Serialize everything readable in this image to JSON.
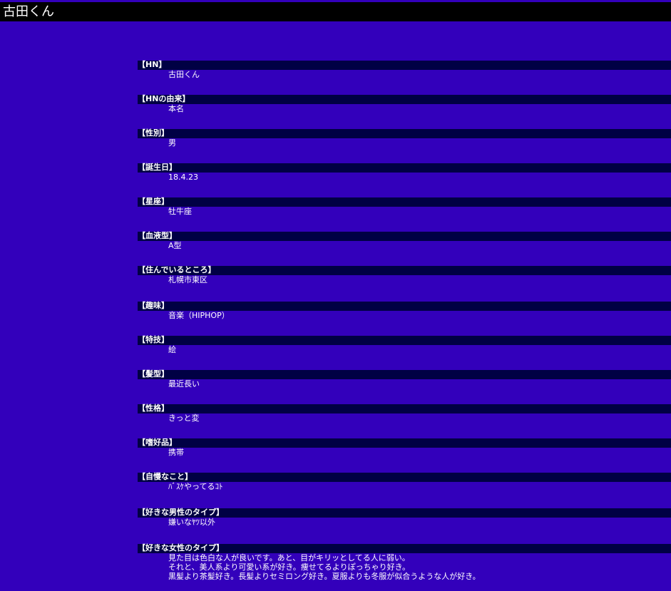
{
  "page": {
    "title": "古田くん"
  },
  "profile": {
    "fields": [
      {
        "label": "【HN】",
        "value": "古田くん"
      },
      {
        "label": "【HNの由来】",
        "value": "本名"
      },
      {
        "label": "【性別】",
        "value": "男"
      },
      {
        "label": "【誕生日】",
        "value": "18.4.23"
      },
      {
        "label": "【星座】",
        "value": "牡牛座"
      },
      {
        "label": "【血液型】",
        "value": "A型"
      },
      {
        "label": "【住んでいるところ】",
        "value": "札幌市東区"
      },
      {
        "label": "【趣味】",
        "value": "音楽（HIPHOP）"
      },
      {
        "label": "【特技】",
        "value": "絵"
      },
      {
        "label": "【髪型】",
        "value": "最近長い"
      },
      {
        "label": "【性格】",
        "value": "きっと変"
      },
      {
        "label": "【嗜好品】",
        "value": "携帯"
      },
      {
        "label": "【自慢なこと】",
        "value": "ﾊﾞｽｹやってるｺﾄ"
      },
      {
        "label": "【好きな男性のタイプ】",
        "value": "嫌いなﾔﾂ以外"
      },
      {
        "label": "【好きな女性のタイプ】",
        "lines": [
          "見た目は色白な人が良いです。あと、目がキリッとしてる人に弱い。",
          "それと、美人系より可愛い系が好き。痩せてるよりぽっちゃり好き。",
          "黒髪より茶髪好き。長髪よりセミロング好き。夏服よりも冬服が似合うような人が好き。"
        ]
      }
    ]
  }
}
